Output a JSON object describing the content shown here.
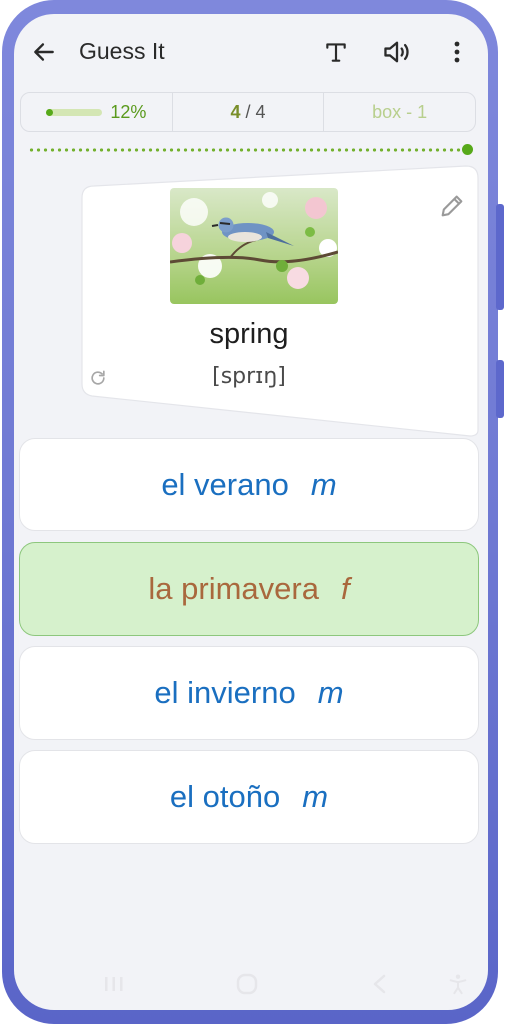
{
  "app": {
    "title": "Guess It"
  },
  "stats": {
    "progress_fraction": 0.12,
    "progress_label": "12%",
    "count_current": "4",
    "count_sep": " / ",
    "count_total": "4",
    "box_label": "box - 1"
  },
  "card": {
    "image_name": "bird-on-blossom-branch",
    "word": "spring",
    "phonetic": "[sprɪŋ]"
  },
  "options": [
    {
      "word": "el verano",
      "gender": "m",
      "state": "default"
    },
    {
      "word": "la primavera",
      "gender": "f",
      "state": "correct"
    },
    {
      "word": "el invierno",
      "gender": "m",
      "state": "default"
    },
    {
      "word": "el otoño",
      "gender": "m",
      "state": "default"
    }
  ],
  "colors": {
    "accent_green": "#57a91a",
    "option_text_blue": "#1a6fc0",
    "correct_bg": "#d6f1cc",
    "correct_text": "#a9683d",
    "frame_purple": "#6f79d3"
  }
}
